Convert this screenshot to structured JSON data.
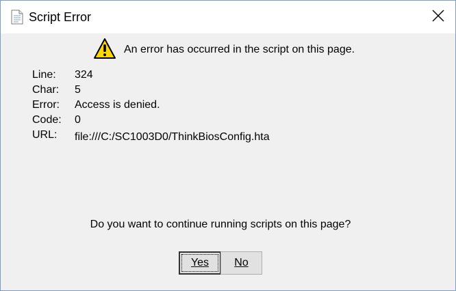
{
  "window": {
    "title": "Script Error",
    "title_icon": "document-icon",
    "close_icon": "close-icon"
  },
  "message": {
    "icon": "warning-icon",
    "headline": "An error has occurred in the script on this page."
  },
  "details": [
    {
      "label": "Line:",
      "value": "324"
    },
    {
      "label": "Char:",
      "value": "5"
    },
    {
      "label": "Error:",
      "value": "Access is denied."
    },
    {
      "label": "Code:",
      "value": "0"
    },
    {
      "label": "URL:",
      "value": "file:///C:/SC1003D0/ThinkBiosConfig.hta"
    }
  ],
  "prompt": "Do you want to continue running scripts on this page?",
  "buttons": {
    "yes_label": "Yes",
    "no_label": "No"
  },
  "colors": {
    "dialog_background": "#f0f0f0",
    "warning_yellow": "#ffd800"
  }
}
